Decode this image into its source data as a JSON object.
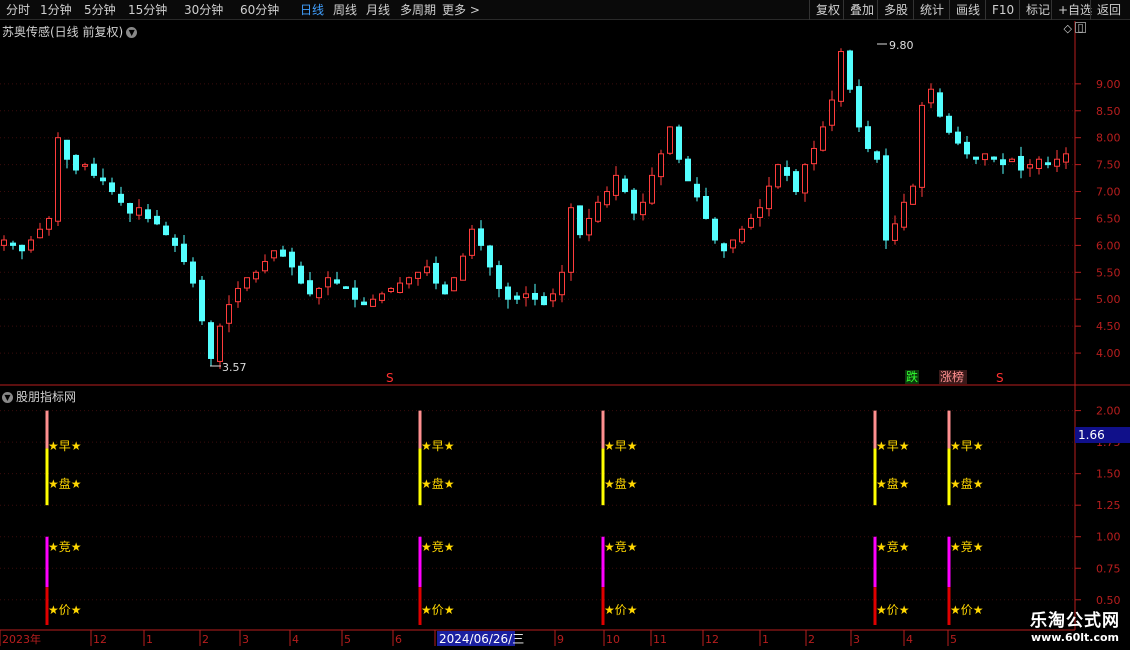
{
  "toolbar": {
    "left": [
      {
        "label": "分时",
        "active": false
      },
      {
        "label": "1分钟",
        "active": false
      },
      {
        "label": "5分钟",
        "active": false
      },
      {
        "label": "15分钟",
        "active": false
      },
      {
        "label": "30分钟",
        "active": false
      },
      {
        "label": "60分钟",
        "active": false
      },
      {
        "label": "日线",
        "active": true
      },
      {
        "label": "周线",
        "active": false
      },
      {
        "label": "月线",
        "active": false
      },
      {
        "label": "多周期",
        "active": false
      },
      {
        "label": "更多 >",
        "active": false
      }
    ],
    "right": [
      "复权",
      "叠加",
      "多股",
      "统计",
      "画线",
      "F10",
      "标记",
      "+自选",
      "返回"
    ]
  },
  "main_panel": {
    "title": "苏奥传感(日线 前复权)",
    "high_label": "9.80",
    "low_label": "3.57",
    "markers": [
      {
        "text": "S",
        "color": "#ff3030"
      },
      {
        "text": "跌",
        "color": "#30ff30"
      },
      {
        "text": "涨榜",
        "color": "#ff6060"
      },
      {
        "text": "S",
        "color": "#ff3030"
      }
    ]
  },
  "indicator_panel": {
    "title": "股朋指标网",
    "current_value": "1.66",
    "labels": [
      "早",
      "盘",
      "竞",
      "价"
    ],
    "star": "★",
    "signal_count": 5
  },
  "colors": {
    "up": "#ff3c3c",
    "down": "#54ffff",
    "axis": "#b81e1e",
    "signal_top": "#ff9090",
    "signal_yellow": "#ffff00",
    "signal_magenta": "#ff00ff",
    "signal_red": "#e00000"
  },
  "chart_data": [
    {
      "type": "candlestick",
      "title": "苏奥传感(日线 前复权)",
      "y_ticks": [
        "9.00",
        "8.50",
        "8.00",
        "7.50",
        "7.00",
        "6.50",
        "6.00",
        "5.50",
        "5.00",
        "4.50",
        "4.00"
      ],
      "ylim": [
        3.5,
        10.0
      ],
      "annotations": [
        {
          "text": "9.80",
          "value": 9.8
        },
        {
          "text": "3.57",
          "value": 3.57
        }
      ],
      "x_labels": [
        "2023年",
        "12",
        "1",
        "2",
        "3",
        "4",
        "5",
        "6",
        "2024/06/26/三",
        "9",
        "10",
        "11",
        "12",
        "1",
        "2",
        "3",
        "4",
        "5"
      ],
      "close_series": [
        6.1,
        6.0,
        5.9,
        6.1,
        6.3,
        6.5,
        8.0,
        7.6,
        7.4,
        7.5,
        7.3,
        7.2,
        7.0,
        6.8,
        6.6,
        6.7,
        6.5,
        6.4,
        6.2,
        6.0,
        5.7,
        5.3,
        4.6,
        3.9,
        4.5,
        4.9,
        5.2,
        5.4,
        5.5,
        5.7,
        5.9,
        5.8,
        5.6,
        5.3,
        5.1,
        5.2,
        5.4,
        5.3,
        5.2,
        5.0,
        4.9,
        5.0,
        5.1,
        5.2,
        5.3,
        5.4,
        5.5,
        5.6,
        5.3,
        5.1,
        5.4,
        5.8,
        6.3,
        6.0,
        5.6,
        5.2,
        5.0,
        5.0,
        5.1,
        5.0,
        4.9,
        5.1,
        5.5,
        6.7,
        6.2,
        6.5,
        6.8,
        7.0,
        7.3,
        7.0,
        6.6,
        6.8,
        7.3,
        7.7,
        8.2,
        7.6,
        7.2,
        6.9,
        6.5,
        6.1,
        5.9,
        6.1,
        6.3,
        6.5,
        6.7,
        7.1,
        7.5,
        7.3,
        7.0,
        7.5,
        7.8,
        8.2,
        8.7,
        9.6,
        8.9,
        8.2,
        7.8,
        7.6,
        6.1,
        6.4,
        6.8,
        7.1,
        8.6,
        8.9,
        8.4,
        8.1,
        7.9,
        7.7,
        7.6,
        7.7,
        7.6,
        7.5,
        7.6,
        7.4,
        7.5,
        7.6,
        7.5,
        7.6,
        7.7
      ]
    },
    {
      "type": "bar",
      "title": "股朋指标网",
      "y_ticks": [
        "2.00",
        "1.75",
        "1.50",
        "1.25",
        "1.00",
        "0.75",
        "0.50"
      ],
      "ylim": [
        0.3,
        2.1
      ],
      "signal_value": 2.0
    }
  ]
}
